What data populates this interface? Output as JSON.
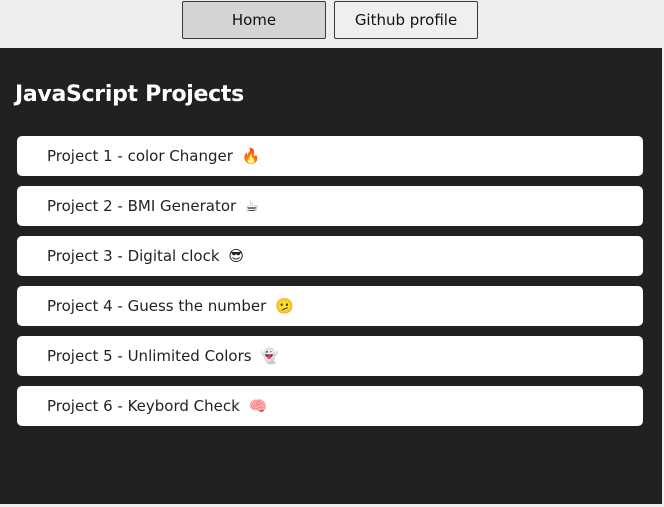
{
  "nav": {
    "home_label": "Home",
    "github_label": "Github profile"
  },
  "main": {
    "title": "JavaScript Projects",
    "projects": [
      {
        "label": "Project 1 - color Changer",
        "emoji": "🔥"
      },
      {
        "label": "Project 2 - BMI Generator",
        "emoji": "☕"
      },
      {
        "label": "Project 3 - Digital clock",
        "emoji": "😎"
      },
      {
        "label": "Project 4 - Guess the number",
        "emoji": "🫤"
      },
      {
        "label": "Project 5 - Unlimited Colors",
        "emoji": "👻"
      },
      {
        "label": "Project 6 - Keybord Check",
        "emoji": "🧠"
      }
    ]
  },
  "colors": {
    "page_bg": "#eeeeee",
    "main_bg": "#212121",
    "card_bg": "#ffffff",
    "home_button_bg": "#d4d4d4"
  }
}
